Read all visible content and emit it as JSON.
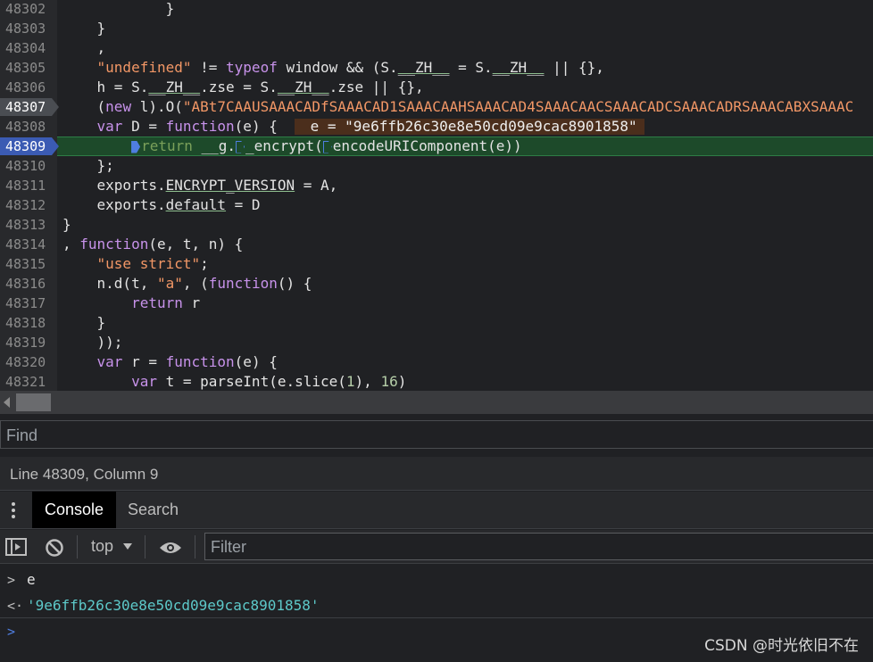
{
  "editor": {
    "lines": [
      {
        "num": "48302",
        "segs": [
          {
            "t": "            }",
            "c": ""
          }
        ]
      },
      {
        "num": "48303",
        "segs": [
          {
            "t": "    }",
            "c": ""
          }
        ]
      },
      {
        "num": "48304",
        "segs": [
          {
            "t": "    ,",
            "c": ""
          }
        ]
      },
      {
        "num": "48305",
        "segs": [
          {
            "t": "    ",
            "c": ""
          },
          {
            "t": "\"undefined\"",
            "c": "str"
          },
          {
            "t": " != ",
            "c": ""
          },
          {
            "t": "typeof",
            "c": "kw"
          },
          {
            "t": " window && (S.",
            "c": ""
          },
          {
            "t": "__ZH__",
            "c": "ul"
          },
          {
            "t": " = S.",
            "c": ""
          },
          {
            "t": "__ZH__",
            "c": "ul"
          },
          {
            "t": " || {},",
            "c": ""
          }
        ]
      },
      {
        "num": "48306",
        "segs": [
          {
            "t": "    h = S.",
            "c": ""
          },
          {
            "t": "__ZH__",
            "c": "ul"
          },
          {
            "t": ".zse = S.",
            "c": ""
          },
          {
            "t": "__ZH__",
            "c": "ul"
          },
          {
            "t": ".zse || {},",
            "c": ""
          }
        ]
      },
      {
        "num": "48307",
        "segs": [
          {
            "t": "    (",
            "c": ""
          },
          {
            "t": "new",
            "c": "kw"
          },
          {
            "t": " l).O(",
            "c": ""
          },
          {
            "t": "\"ABt7CAAUSAAACADfSAAACAD1SAAACAAHSAAACAD4SAAACAACSAAACADCSAAACADRSAAACABXSAAAC",
            "c": "str"
          }
        ]
      },
      {
        "num": "48308",
        "segs": [
          {
            "t": "    ",
            "c": ""
          },
          {
            "t": "var",
            "c": "kw"
          },
          {
            "t": " D = ",
            "c": ""
          },
          {
            "t": "function",
            "c": "kw"
          },
          {
            "t": "(e) {",
            "c": ""
          }
        ]
      },
      {
        "num": "48309",
        "segs": []
      },
      {
        "num": "48310",
        "segs": [
          {
            "t": "    };",
            "c": ""
          }
        ]
      },
      {
        "num": "48311",
        "segs": [
          {
            "t": "    exports.",
            "c": ""
          },
          {
            "t": "ENCRYPT_VERSION",
            "c": "ul"
          },
          {
            "t": " = A,",
            "c": ""
          }
        ]
      },
      {
        "num": "48312",
        "segs": [
          {
            "t": "    exports.",
            "c": ""
          },
          {
            "t": "default",
            "c": "ul"
          },
          {
            "t": " = D",
            "c": ""
          }
        ]
      },
      {
        "num": "48313",
        "segs": [
          {
            "t": "}",
            "c": ""
          }
        ]
      },
      {
        "num": "48314",
        "segs": [
          {
            "t": ", ",
            "c": ""
          },
          {
            "t": "function",
            "c": "kw"
          },
          {
            "t": "(e, t, n) {",
            "c": ""
          }
        ]
      },
      {
        "num": "48315",
        "segs": [
          {
            "t": "    ",
            "c": ""
          },
          {
            "t": "\"use strict\"",
            "c": "str"
          },
          {
            "t": ";",
            "c": ""
          }
        ]
      },
      {
        "num": "48316",
        "segs": [
          {
            "t": "    n.d(t, ",
            "c": ""
          },
          {
            "t": "\"a\"",
            "c": "str"
          },
          {
            "t": ", (",
            "c": ""
          },
          {
            "t": "function",
            "c": "kw"
          },
          {
            "t": "() {",
            "c": ""
          }
        ]
      },
      {
        "num": "48317",
        "segs": [
          {
            "t": "        ",
            "c": ""
          },
          {
            "t": "return",
            "c": "kw"
          },
          {
            "t": " r",
            "c": ""
          }
        ]
      },
      {
        "num": "48318",
        "segs": [
          {
            "t": "    }",
            "c": ""
          }
        ]
      },
      {
        "num": "48319",
        "segs": [
          {
            "t": "    ));",
            "c": ""
          }
        ]
      },
      {
        "num": "48320",
        "segs": [
          {
            "t": "    ",
            "c": ""
          },
          {
            "t": "var",
            "c": "kw"
          },
          {
            "t": " r = ",
            "c": ""
          },
          {
            "t": "function",
            "c": "kw"
          },
          {
            "t": "(e) {",
            "c": ""
          }
        ]
      },
      {
        "num": "48321",
        "segs": [
          {
            "t": "        ",
            "c": ""
          },
          {
            "t": "var",
            "c": "kw"
          },
          {
            "t": " t = parseInt(e.slice(",
            "c": ""
          },
          {
            "t": "1",
            "c": "num"
          },
          {
            "t": "), ",
            "c": ""
          },
          {
            "t": "16",
            "c": "num"
          },
          {
            "t": ")",
            "c": ""
          }
        ]
      }
    ],
    "inline_value": " e = \"9e6ffb26c30e8e50cd09e9cac8901858\"",
    "paused_line": {
      "kw": "return",
      "mid": " __g.",
      "fn": "_encrypt",
      "paren": "(",
      "arg": "encodeURIComponent(e))"
    }
  },
  "find": {
    "placeholder": "Find"
  },
  "status": {
    "text": "Line 48309, Column 9"
  },
  "tabs": [
    {
      "label": "Console"
    },
    {
      "label": "Search"
    }
  ],
  "toolbar": {
    "context": "top",
    "filter_placeholder": "Filter"
  },
  "console": {
    "input": "e",
    "result": "'9e6ffb26c30e8e50cd09e9cac8901858'"
  },
  "watermark": "CSDN @时光依旧不在",
  "colors": {
    "keyword": "#c792ea",
    "string": "#f29766",
    "number": "#b5cea8",
    "exec_line": "#1d4a2a",
    "breakpoint": "#3b5bb3",
    "result": "#5dc9c9"
  }
}
